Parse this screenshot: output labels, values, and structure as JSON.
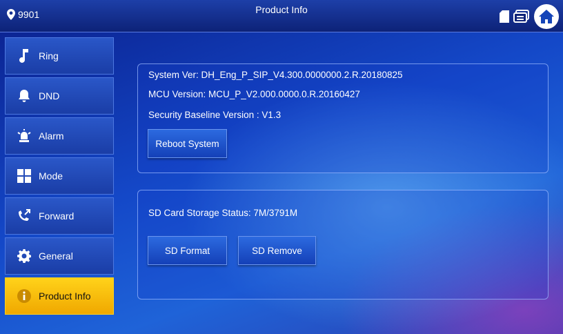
{
  "header": {
    "location": "9901",
    "title": "Product Info"
  },
  "sidebar": {
    "items": [
      {
        "label": "Ring",
        "icon": "music-note-icon"
      },
      {
        "label": "DND",
        "icon": "bell-mute-icon"
      },
      {
        "label": "Alarm",
        "icon": "siren-icon"
      },
      {
        "label": "Mode",
        "icon": "grid-icon"
      },
      {
        "label": "Forward",
        "icon": "call-forward-icon"
      },
      {
        "label": "General",
        "icon": "gear-icon"
      },
      {
        "label": "Product Info",
        "icon": "info-icon",
        "active": true
      }
    ]
  },
  "system_panel": {
    "system_ver": "System Ver: DH_Eng_P_SIP_V4.300.0000000.2.R.20180825",
    "mcu_version": "MCU Version: MCU_P_V2.000.0000.0.R.20160427",
    "security_baseline": "Security Baseline Version : V1.3",
    "reboot_label": "Reboot System"
  },
  "sd_panel": {
    "status": "SD Card Storage Status: 7M/3791M",
    "format_label": "SD Format",
    "remove_label": "SD Remove"
  },
  "colors": {
    "active_tab": "#ffc20e",
    "accent": "#1f63d8"
  }
}
